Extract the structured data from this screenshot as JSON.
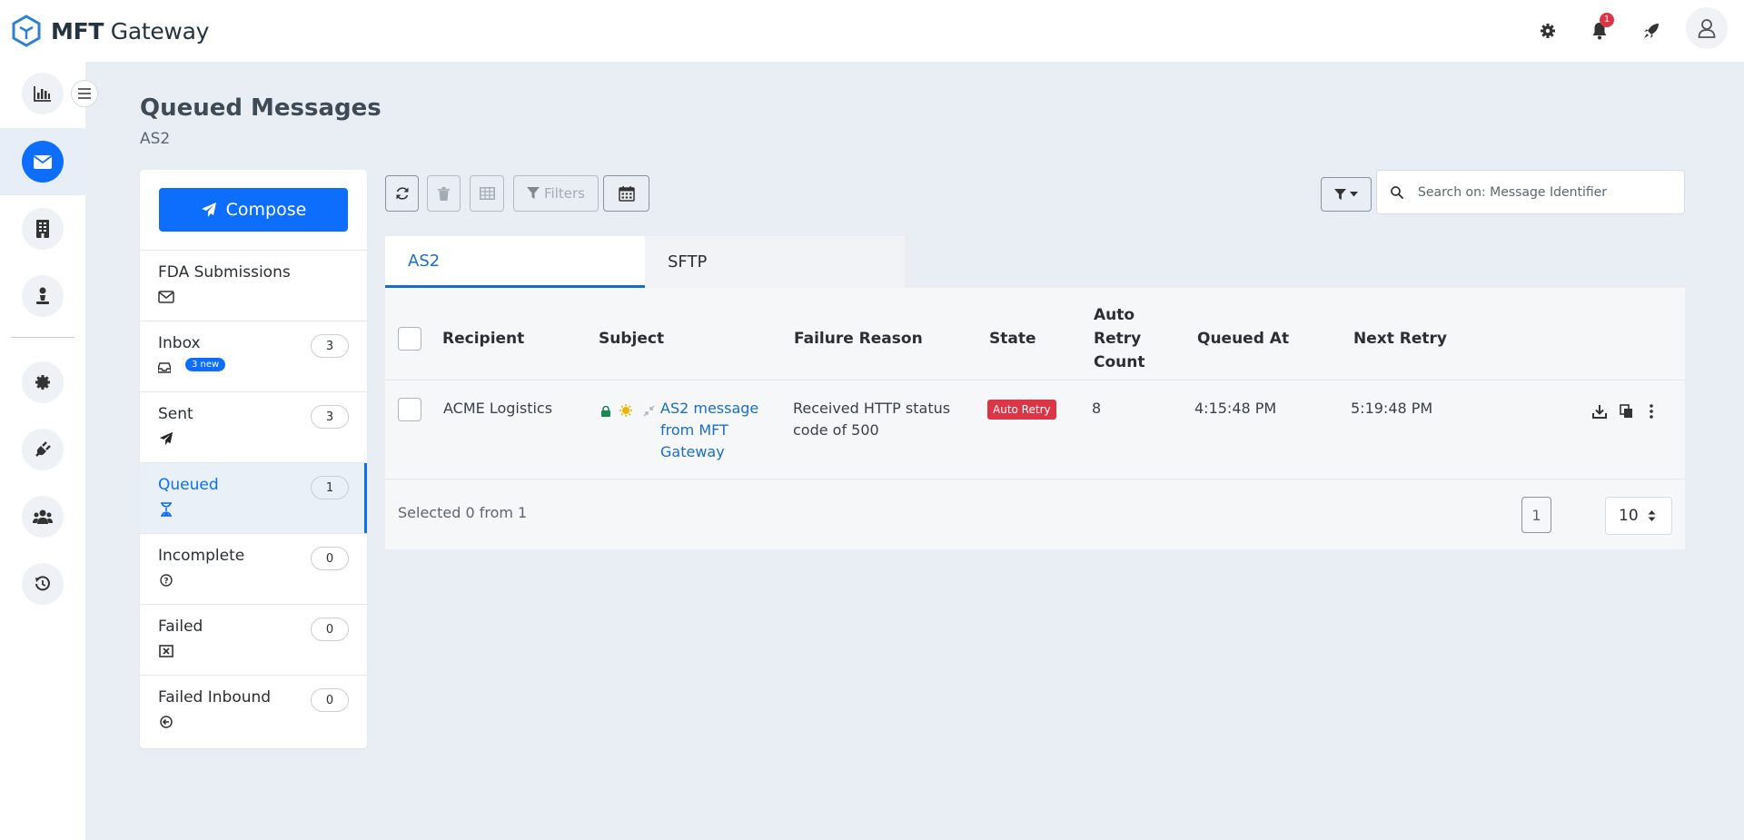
{
  "app": {
    "brand_bold": "MFT",
    "brand_rest": " Gateway"
  },
  "topbar": {
    "notifications_count": "1"
  },
  "header": {
    "title": "Queued Messages",
    "subtitle": "AS2"
  },
  "folders": {
    "compose_label": "Compose",
    "items": [
      {
        "label": "FDA Submissions",
        "count": "",
        "icon": "envelope-icon"
      },
      {
        "label": "Inbox",
        "count": "3",
        "badge": "3 new",
        "icon": "inbox-icon"
      },
      {
        "label": "Sent",
        "count": "3",
        "icon": "paper-plane-icon"
      },
      {
        "label": "Queued",
        "count": "1",
        "icon": "hourglass-icon"
      },
      {
        "label": "Incomplete",
        "count": "0",
        "icon": "question-circle-icon"
      },
      {
        "label": "Failed",
        "count": "0",
        "icon": "x-square-icon"
      },
      {
        "label": "Failed Inbound",
        "count": "0",
        "icon": "arrow-circle-left-icon"
      }
    ]
  },
  "toolbar": {
    "filters_label": "Filters",
    "search_placeholder": "Search on: Message Identifier"
  },
  "tabs": [
    {
      "label": "AS2"
    },
    {
      "label": "SFTP"
    }
  ],
  "table": {
    "columns": {
      "recipient": "Recipient",
      "subject": "Subject",
      "failure_reason": "Failure Reason",
      "state": "State",
      "auto_retry_1": "Auto",
      "auto_retry_2": "Retry",
      "auto_retry_3": "Count",
      "queued_at": "Queued At",
      "next_retry": "Next Retry"
    },
    "rows": [
      {
        "recipient": "ACME Logistics",
        "subject_1": "AS2 message",
        "subject_2": "from MFT",
        "subject_3": "Gateway",
        "failure_1": "Received HTTP status",
        "failure_2": "code of 500",
        "state": "Auto Retry",
        "retry_count": "8",
        "queued_at": "4:15:48 PM",
        "next_retry": "5:19:48 PM"
      }
    ],
    "selected_info": "Selected 0 from 1",
    "page": "1",
    "page_size": "10"
  },
  "colors": {
    "primary": "#0d6efd",
    "danger": "#dc3545",
    "background": "#e9eef5"
  }
}
